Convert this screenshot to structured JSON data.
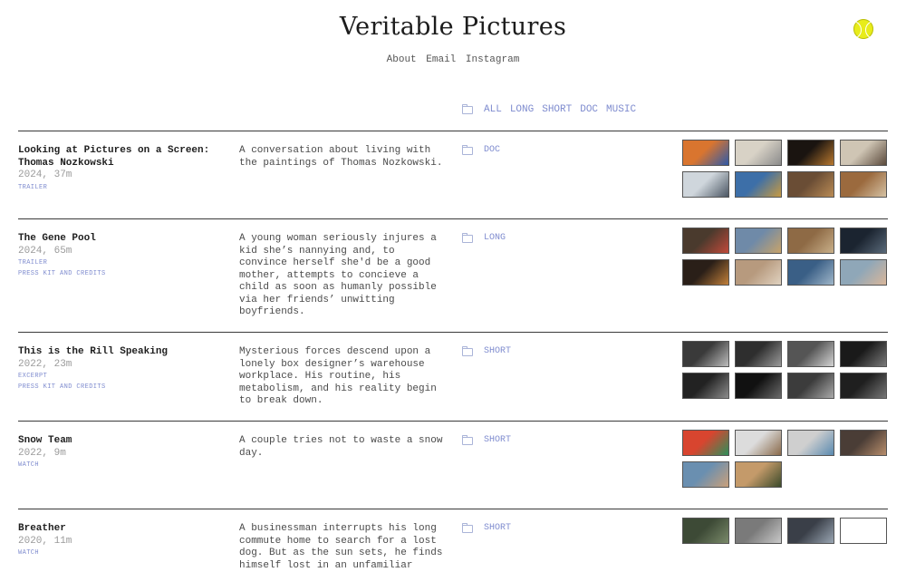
{
  "site": {
    "title": "Veritable Pictures"
  },
  "nav": [
    "About",
    "Email",
    "Instagram"
  ],
  "filters": [
    "ALL",
    "LONG",
    "SHORT",
    "DOC",
    "MUSIC"
  ],
  "films": [
    {
      "title": "Looking at Pictures on a Screen: Thomas Nozkowski",
      "meta": "2024, 37m",
      "links": [
        "TRAILER"
      ],
      "description": "A conversation about living with the paintings of Thomas Nozkowski.",
      "category": "DOC",
      "thumbs": [
        [
          "#d9752f",
          "#2f5aa8"
        ],
        [
          "#d8d2c6",
          "#8b8b8b"
        ],
        [
          "#1a1410",
          "#b8782f"
        ],
        [
          "#cfc5b4",
          "#5b4a3c"
        ],
        [
          "#cfd6dc",
          "#4b5663"
        ],
        [
          "#3d6fa8",
          "#c79a42"
        ],
        [
          "#6a4d35",
          "#b98b55"
        ],
        [
          "#9b6a3e",
          "#d5c2a4"
        ]
      ]
    },
    {
      "title": "The Gene Pool",
      "meta": "2024, 65m",
      "links": [
        "TRAILER",
        "PRESS KIT AND CREDITS"
      ],
      "description": "A young woman seriously injures a kid she’s nannying and, to convince herself she'd be a good mother, attempts to concieve a child as soon as humanly possible via her friends’ unwitting boyfriends.",
      "category": "LONG",
      "thumbs": [
        [
          "#4a3a2d",
          "#c14a3a"
        ],
        [
          "#6f8aa8",
          "#c8a36a"
        ],
        [
          "#8e6a45",
          "#c9b08a"
        ],
        [
          "#1b2430",
          "#5a6a7a"
        ],
        [
          "#2a1f18",
          "#c2803a"
        ],
        [
          "#b79a7e",
          "#e0d2c0"
        ],
        [
          "#3a5f86",
          "#9fb6c9"
        ],
        [
          "#8fa7b8",
          "#d9b69a"
        ]
      ]
    },
    {
      "title": "This is the Rill Speaking",
      "meta": "2022, 23m",
      "links": [
        "EXCERPT",
        "PRESS KIT AND CREDITS"
      ],
      "description": "Mysterious forces descend upon a lonely box designer’s warehouse workplace. His routine, his metabolism, and his reality begin to break down.",
      "category": "SHORT",
      "thumbs": [
        [
          "#3a3a3a",
          "#bdbdbd"
        ],
        [
          "#2e2e2e",
          "#9a9a9a"
        ],
        [
          "#555555",
          "#d4d4d4"
        ],
        [
          "#1a1a1a",
          "#7a7a7a"
        ],
        [
          "#222222",
          "#8c8c8c"
        ],
        [
          "#111111",
          "#6a6a6a"
        ],
        [
          "#3c3c3c",
          "#aaaaaa"
        ],
        [
          "#1f1f1f",
          "#777777"
        ]
      ]
    },
    {
      "title": "Snow Team",
      "meta": "2022, 9m",
      "links": [
        "WATCH"
      ],
      "description": "A couple tries not to waste a snow day.",
      "category": "SHORT",
      "thumbs": [
        [
          "#d8452f",
          "#2d8f5a"
        ],
        [
          "#dcdcdc",
          "#8a6a4a"
        ],
        [
          "#cfcfcf",
          "#5a8ab0"
        ],
        [
          "#4a3d36",
          "#b88e6c"
        ],
        [
          "#6a8fb0",
          "#c9a07a"
        ],
        [
          "#c49a6a",
          "#3a4a2a"
        ]
      ]
    },
    {
      "title": "Breather",
      "meta": "2020, 11m",
      "links": [
        "WATCH"
      ],
      "description": "A businessman interrupts his long commute home to search for a lost dog. But as the sun sets, he finds himself lost in an unfamiliar",
      "category": "SHORT",
      "thumbs": [
        [
          "#3d4a36",
          "#7a8a6a"
        ],
        [
          "#7a7a7a",
          "#c9c9c9"
        ],
        [
          "#3a3f48",
          "#9aa6b3"
        ],
        [
          "#ffffff",
          "#ffffff"
        ]
      ]
    }
  ]
}
